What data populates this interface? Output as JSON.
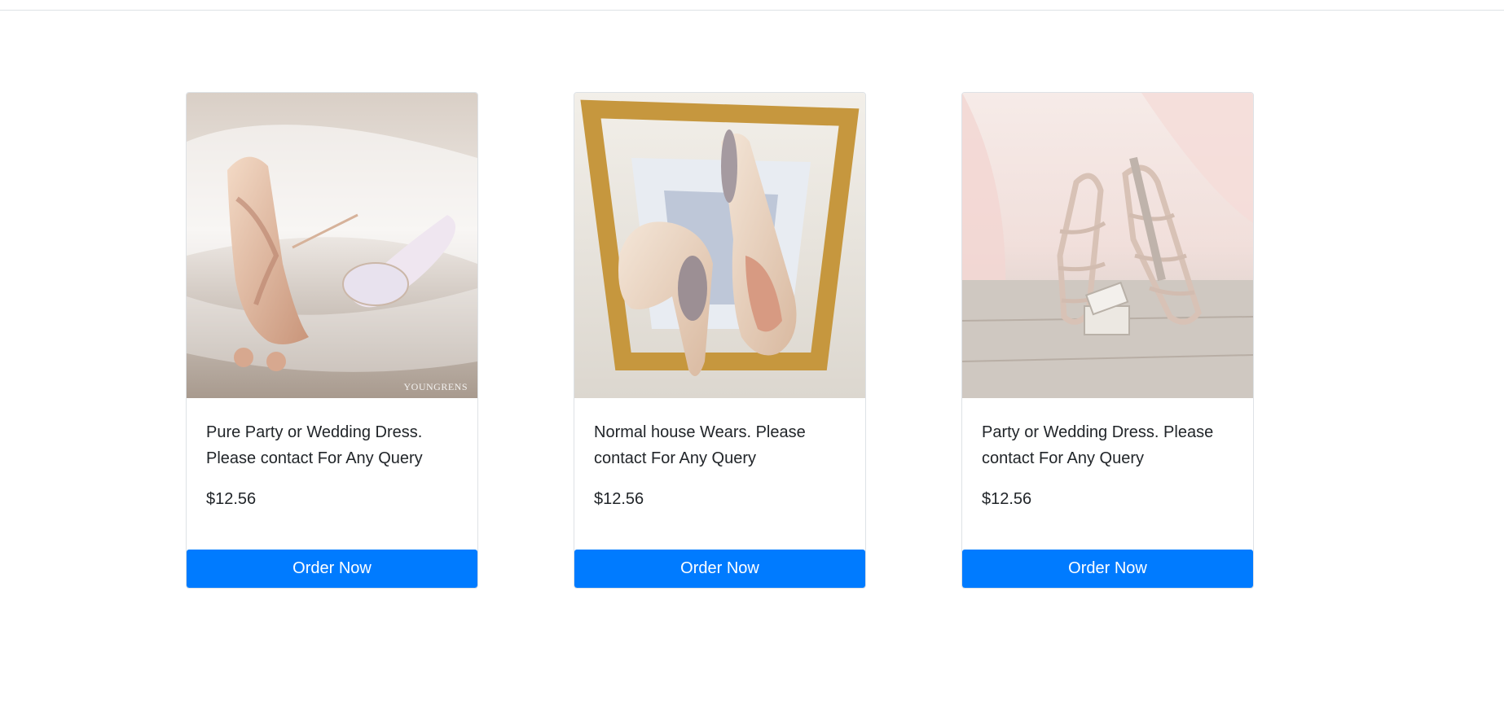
{
  "products": [
    {
      "image_icon": "wedding-heels-rose-gold-image",
      "watermark": "YOUNGRENS",
      "description": "Pure Party or Wedding Dress. Please contact For Any Query",
      "price": "$12.56",
      "button_label": "Order Now"
    },
    {
      "image_icon": "nude-pumps-jeweled-heel-image",
      "description": "Normal house Wears. Please contact For Any Query",
      "price": "$12.56",
      "button_label": "Order Now"
    },
    {
      "image_icon": "strappy-sandals-ring-box-image",
      "description": "Party or Wedding Dress. Please contact For Any Query",
      "price": "$12.56",
      "button_label": "Order Now"
    }
  ],
  "colors": {
    "button": "#007bff",
    "border": "#dee2e6",
    "text": "#212529"
  }
}
